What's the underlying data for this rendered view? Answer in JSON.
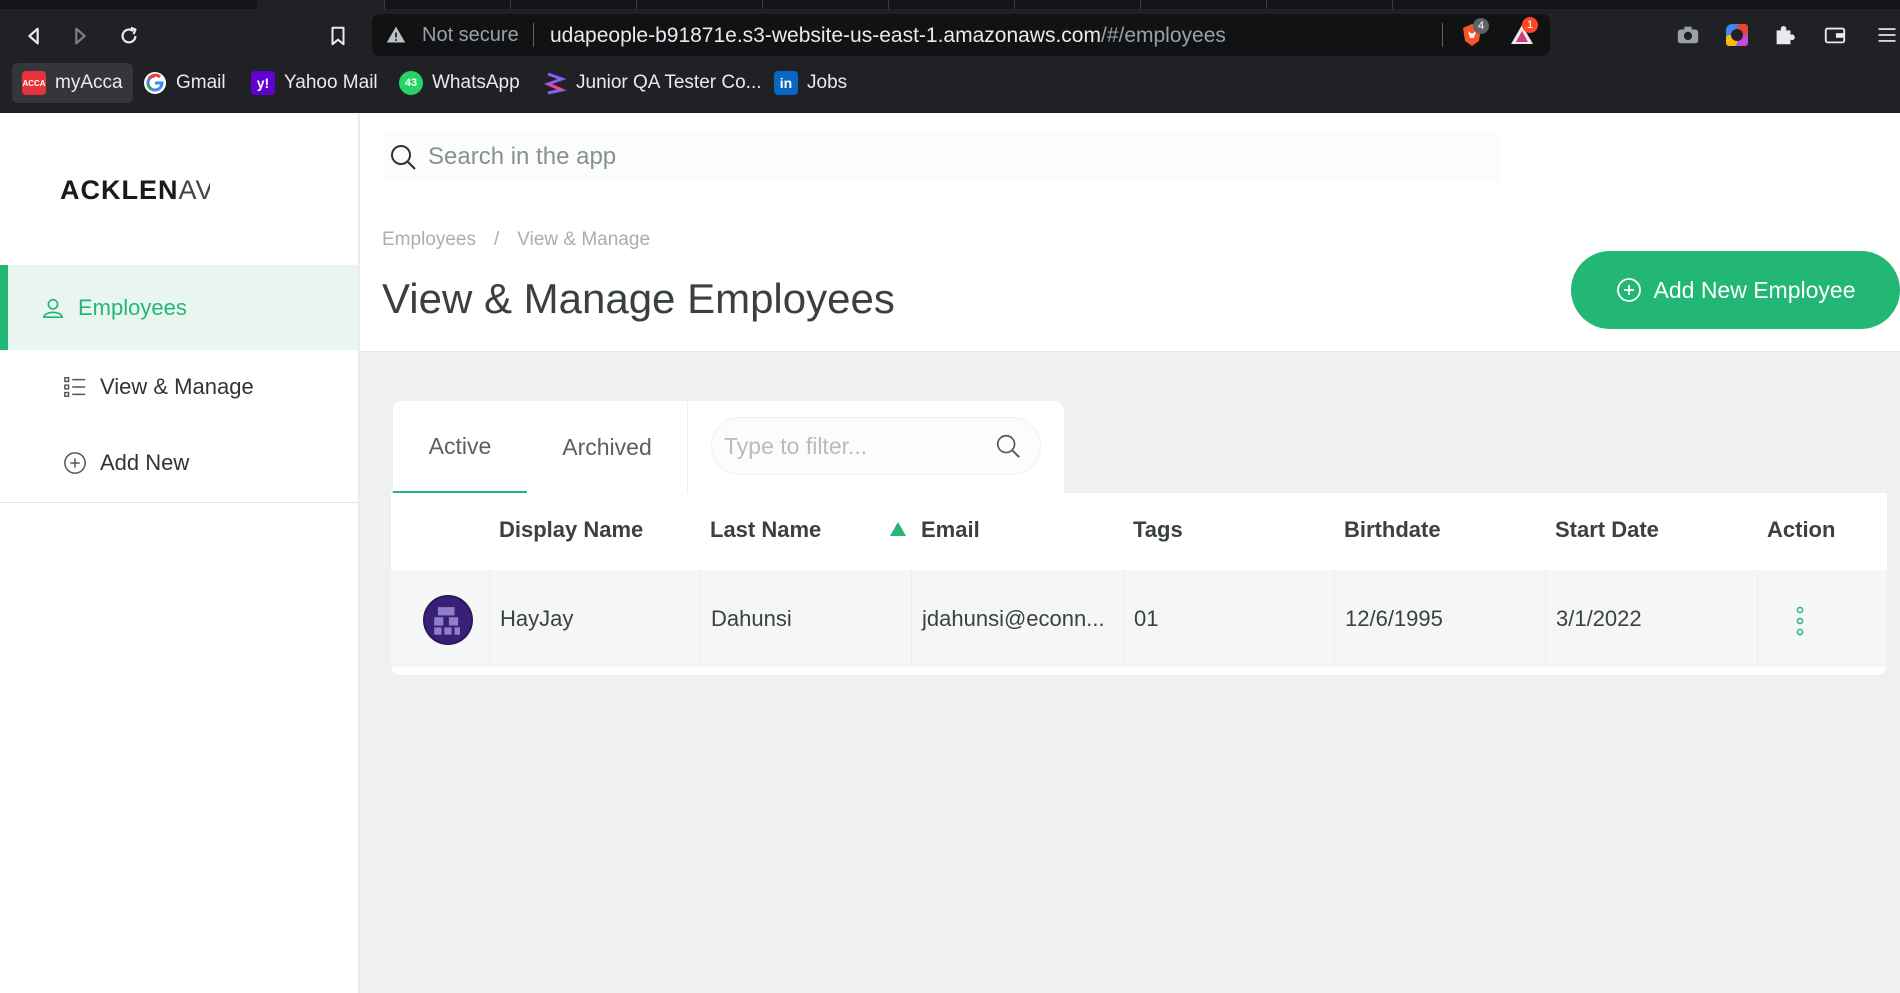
{
  "browser": {
    "omnibox": {
      "security_label": "Not secure",
      "url_host": "udapeople-b91871e.s3-website-us-east-1.amazonaws.com",
      "url_path": "/#/employees"
    },
    "extensions": [
      {
        "icon": "brave-shield-icon",
        "badge": "4"
      },
      {
        "icon": "brave-rewards-icon",
        "badge": "1"
      }
    ],
    "bookmarks": [
      {
        "label": "myAcca",
        "icon": "acca-icon"
      },
      {
        "label": "Gmail",
        "icon": "google-icon"
      },
      {
        "label": "Yahoo Mail",
        "icon": "yahoo-icon"
      },
      {
        "label": "WhatsApp",
        "icon": "whatsapp-icon",
        "badge": "43"
      },
      {
        "label": "Junior QA Tester Co...",
        "icon": "site-icon"
      },
      {
        "label": "Jobs",
        "icon": "linkedin-icon"
      }
    ]
  },
  "app": {
    "logo_bold": "ACKLEN",
    "logo_thin": "AV",
    "sidebar": {
      "section": "Employees",
      "items": [
        {
          "label": "View & Manage",
          "icon": "list-icon"
        },
        {
          "label": "Add New",
          "icon": "plus-circle-icon"
        }
      ]
    },
    "search": {
      "placeholder": "Search in the app"
    },
    "breadcrumb": [
      "Employees",
      "/",
      "View & Manage"
    ],
    "page_title": "View & Manage Employees",
    "add_button": "Add New Employee",
    "tabs": [
      "Active",
      "Archived"
    ],
    "filter": {
      "placeholder": "Type to filter..."
    },
    "table": {
      "columns": [
        "Display Name",
        "Last Name",
        "Email",
        "Tags",
        "Birthdate",
        "Start Date",
        "Action"
      ],
      "sorted_column": "Email",
      "rows": [
        {
          "display_name": "HayJay",
          "last_name": "Dahunsi",
          "email": "jdahunsi@econn...",
          "tags": "01",
          "birthdate": "12/6/1995",
          "start_date": "3/1/2022"
        }
      ]
    }
  },
  "colors": {
    "accent": "#23b776",
    "chrome_bg": "#202124",
    "avatar": "#3a1f78"
  }
}
